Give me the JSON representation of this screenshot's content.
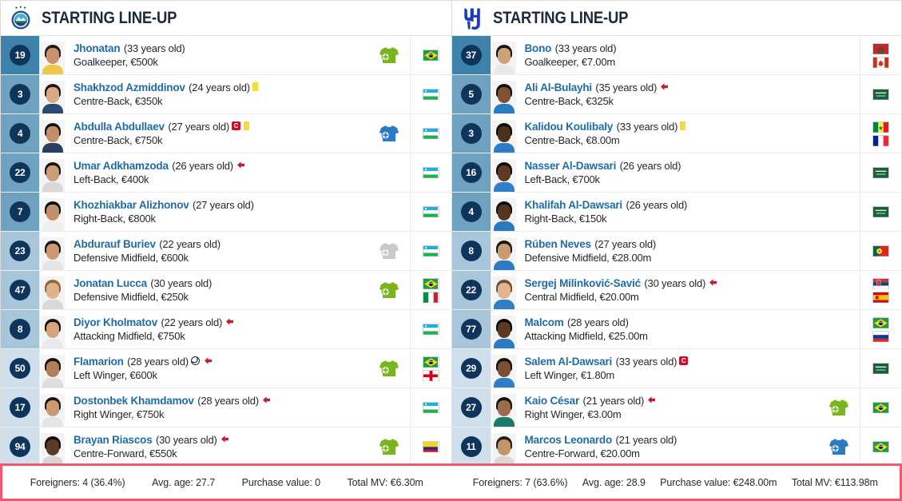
{
  "left": {
    "title": "STARTING LINE-UP",
    "club": "club-crest-pakhtakor",
    "header_num_color": "#3d82ab",
    "players": [
      {
        "number": "19",
        "name": "Jhonatan",
        "age": "(33 years old)",
        "position_value": "Goalkeeper, €500k",
        "badges": [],
        "sub": "in-green",
        "flags": [
          "BR"
        ],
        "numbg": "#3d82ab",
        "face": {
          "hair": "#231a14",
          "skin": "#c79270",
          "torso": "#efc64a"
        }
      },
      {
        "number": "3",
        "name": "Shakhzod Azmiddinov",
        "age": "(24 years old)",
        "position_value": "Centre-Back, €350k",
        "badges": [
          "yellow-card"
        ],
        "sub": "none",
        "flags": [
          "UZ"
        ],
        "numbg": "#6fa2c0",
        "face": {
          "hair": "#1d1913",
          "skin": "#d7a985",
          "torso": "#2b4a73"
        }
      },
      {
        "number": "4",
        "name": "Abdulla Abdullaev",
        "age": "(27 years old)",
        "position_value": "Centre-Back, €750k",
        "badges": [
          "captain",
          "yellow-card"
        ],
        "sub": "out-blue",
        "flags": [
          "UZ"
        ],
        "numbg": "#6fa2c0",
        "face": {
          "hair": "#15110d",
          "skin": "#c08f68",
          "torso": "#27405f"
        }
      },
      {
        "number": "22",
        "name": "Umar Adkhamzoda",
        "age": "(26 years old)",
        "position_value": "Left-Back, €400k",
        "badges": [
          "red-arrow"
        ],
        "sub": "none",
        "flags": [
          "UZ"
        ],
        "numbg": "#6fa2c0",
        "face": {
          "hair": "#18130e",
          "skin": "#cd9d77",
          "torso": "#d8d8d8"
        }
      },
      {
        "number": "7",
        "name": "Khozhiakbar Alizhonov",
        "age": "(27 years old)",
        "position_value": "Right-Back, €800k",
        "badges": [],
        "sub": "none",
        "flags": [
          "UZ"
        ],
        "numbg": "#6fa2c0",
        "face": {
          "hair": "#120f0b",
          "skin": "#c1906a",
          "torso": "#eeeeee"
        }
      },
      {
        "number": "23",
        "name": "Abdurauf Buriev",
        "age": "(22 years old)",
        "position_value": "Defensive Midfield, €600k",
        "badges": [],
        "sub": "in-grey",
        "flags": [
          "UZ"
        ],
        "numbg": "#a8c6d9",
        "face": {
          "hair": "#1b1510",
          "skin": "#cb9a74",
          "torso": "#e6e6e6"
        }
      },
      {
        "number": "47",
        "name": "Jonatan Lucca",
        "age": "(30 years old)",
        "position_value": "Defensive Midfield, €250k",
        "badges": [],
        "sub": "in-green",
        "flags": [
          "BR",
          "IT"
        ],
        "numbg": "#a8c6d9",
        "face": {
          "hair": "#8d6536",
          "skin": "#e0b28c",
          "torso": "#d9d9d9"
        }
      },
      {
        "number": "8",
        "name": "Diyor Kholmatov",
        "age": "(22 years old)",
        "position_value": "Attacking Midfield, €750k",
        "badges": [
          "red-arrow"
        ],
        "sub": "none",
        "flags": [
          "UZ"
        ],
        "numbg": "#a8c6d9",
        "face": {
          "hair": "#14100c",
          "skin": "#d3a47d",
          "torso": "#e9e9e9"
        }
      },
      {
        "number": "50",
        "name": "Flamarion",
        "age": "(28 years old)",
        "position_value": "Left Winger, €600k",
        "badges": [
          "goal",
          "red-arrow"
        ],
        "sub": "in-green",
        "flags": [
          "BR",
          "GE"
        ],
        "numbg": "#cfe0ec",
        "face": {
          "hair": "#17120d",
          "skin": "#b0805c",
          "torso": "#dedede"
        }
      },
      {
        "number": "17",
        "name": "Dostonbek Khamdamov",
        "age": "(28 years old)",
        "position_value": "Right Winger, €750k",
        "badges": [
          "red-arrow"
        ],
        "sub": "none",
        "flags": [
          "UZ"
        ],
        "numbg": "#cfe0ec",
        "face": {
          "hair": "#19140f",
          "skin": "#c99a73",
          "torso": "#e4e4e4"
        }
      },
      {
        "number": "94",
        "name": "Brayan Riascos",
        "age": "(30 years old)",
        "position_value": "Centre-Forward, €550k",
        "badges": [
          "red-arrow"
        ],
        "sub": "in-green",
        "flags": [
          "CO"
        ],
        "numbg": "#cfe0ec",
        "face": {
          "hair": "#100c09",
          "skin": "#5c3b26",
          "torso": "#d6d6d6"
        }
      }
    ],
    "summary": {
      "foreigners": "Foreigners: 4 (36.4%)",
      "avg_age": "Avg. age: 27.7",
      "purchase_value": "Purchase value: 0",
      "total_mv": "Total MV: €6.30m"
    }
  },
  "right": {
    "title": "STARTING LINE-UP",
    "club": "club-crest-al-hilal",
    "players": [
      {
        "number": "37",
        "name": "Bono",
        "age": "(33 years old)",
        "position_value": "Goalkeeper, €7.00m",
        "badges": [],
        "sub": "none",
        "flags": [
          "MA",
          "CA"
        ],
        "numbg": "#3d82ab",
        "face": {
          "hair": "#1a1410",
          "skin": "#cfa178",
          "torso": "#e8e8e8"
        }
      },
      {
        "number": "5",
        "name": "Ali Al-Bulayhi",
        "age": "(35 years old)",
        "position_value": "Centre-Back, €325k",
        "badges": [
          "red-arrow"
        ],
        "sub": "none",
        "flags": [
          "SA"
        ],
        "numbg": "#6fa2c0",
        "face": {
          "hair": "#120d0a",
          "skin": "#7d5334",
          "torso": "#2b7ac4"
        }
      },
      {
        "number": "3",
        "name": "Kalidou Koulibaly",
        "age": "(33 years old)",
        "position_value": "Centre-Back, €8.00m",
        "badges": [
          "yellow-card"
        ],
        "sub": "none",
        "flags": [
          "SN",
          "FR"
        ],
        "numbg": "#6fa2c0",
        "face": {
          "hair": "#0d0907",
          "skin": "#4a2f1d",
          "torso": "#2d7cc6"
        }
      },
      {
        "number": "16",
        "name": "Nasser Al-Dawsari",
        "age": "(26 years old)",
        "position_value": "Left-Back, €700k",
        "badges": [],
        "sub": "none",
        "flags": [
          "SA"
        ],
        "numbg": "#6fa2c0",
        "face": {
          "hair": "#0f0b08",
          "skin": "#5d3b25",
          "torso": "#2e7ec8"
        }
      },
      {
        "number": "4",
        "name": "Khalifah Al-Dawsari",
        "age": "(26 years old)",
        "position_value": "Right-Back, €150k",
        "badges": [],
        "sub": "none",
        "flags": [
          "SA"
        ],
        "numbg": "#6fa2c0",
        "face": {
          "hair": "#100c09",
          "skin": "#56351f",
          "torso": "#2a78c0"
        }
      },
      {
        "number": "8",
        "name": "Rúben Neves",
        "age": "(27 years old)",
        "position_value": "Defensive Midfield, €28.00m",
        "badges": [],
        "sub": "none",
        "flags": [
          "PT"
        ],
        "numbg": "#a8c6d9",
        "face": {
          "hair": "#1b1510",
          "skin": "#c89a72",
          "torso": "#2b7ac4"
        }
      },
      {
        "number": "22",
        "name": "Sergej Milinković-Savić",
        "age": "(30 years old)",
        "position_value": "Central Midfield, €20.00m",
        "badges": [
          "red-arrow"
        ],
        "sub": "none",
        "flags": [
          "RS",
          "ES"
        ],
        "numbg": "#a8c6d9",
        "face": {
          "hair": "#6b5238",
          "skin": "#e2b590",
          "torso": "#2e7ec8"
        }
      },
      {
        "number": "77",
        "name": "Malcom",
        "age": "(28 years old)",
        "position_value": "Attacking Midfield, €25.00m",
        "badges": [],
        "sub": "none",
        "flags": [
          "BR",
          "RU"
        ],
        "numbg": "#a8c6d9",
        "face": {
          "hair": "#0d0906",
          "skin": "#5a3a24",
          "torso": "#2b7ac4"
        }
      },
      {
        "number": "29",
        "name": "Salem Al-Dawsari",
        "age": "(33 years old)",
        "position_value": "Left Winger, €1.80m",
        "badges": [
          "captain"
        ],
        "sub": "none",
        "flags": [
          "SA"
        ],
        "numbg": "#cfe0ec",
        "face": {
          "hair": "#110d0a",
          "skin": "#7a5032",
          "torso": "#2e7ec8"
        }
      },
      {
        "number": "27",
        "name": "Kaio César",
        "age": "(21 years old)",
        "position_value": "Right Winger, €3.00m",
        "badges": [
          "red-arrow"
        ],
        "sub": "in-green",
        "flags": [
          "BR"
        ],
        "numbg": "#cfe0ec",
        "face": {
          "hair": "#14100c",
          "skin": "#9c6c48",
          "torso": "#1d7a6a"
        }
      },
      {
        "number": "11",
        "name": "Marcos Leonardo",
        "age": "(21 years old)",
        "position_value": "Centre-Forward, €20.00m",
        "badges": [],
        "sub": "out-blue",
        "flags": [
          "BR"
        ],
        "numbg": "#cfe0ec",
        "face": {
          "hair": "#2a1d12",
          "skin": "#c59468",
          "torso": "#d8d8d8"
        }
      }
    ],
    "summary": {
      "foreigners": "Foreigners: 7 (63.6%)",
      "avg_age": "Avg. age: 28.9",
      "purchase_value": "Purchase value: €248.00m",
      "total_mv": "Total MV: €113.98m"
    }
  },
  "colors": {
    "accent_red": "#f4566b",
    "link_blue": "#1f6ca8",
    "number_circle": "#10355c",
    "sub_in_green": "#7ab51d",
    "sub_out_blue": "#2b7ac4",
    "sub_grey": "#c9c9c9"
  }
}
